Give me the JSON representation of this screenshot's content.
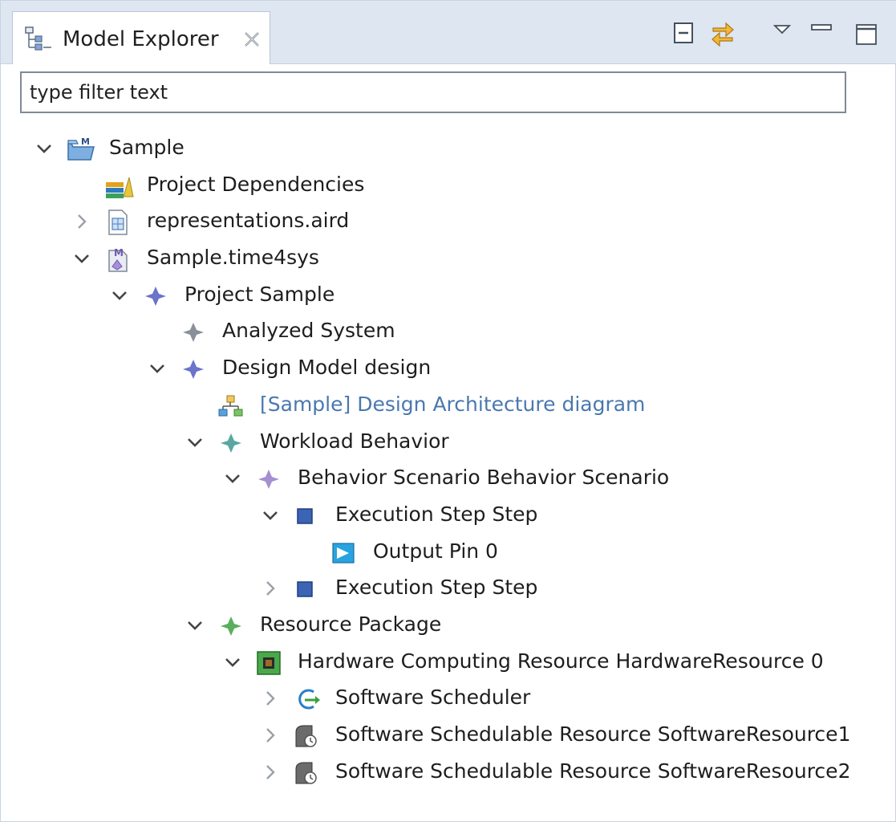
{
  "view": {
    "title": "Model Explorer",
    "filter_value": "type filter text"
  },
  "toolbar": {
    "buttons": [
      "collapse-all-icon",
      "link-with-editor-icon",
      "view-menu-icon",
      "minimize-icon",
      "maximize-icon"
    ]
  },
  "tree": [
    {
      "label": "Sample",
      "depth": 0,
      "toggle": "expanded",
      "icon": "project-folder-icon"
    },
    {
      "label": "Project Dependencies",
      "depth": 1,
      "toggle": "none",
      "icon": "dependencies-icon"
    },
    {
      "label": "representations.aird",
      "depth": 1,
      "toggle": "collapsed",
      "icon": "aird-file-icon"
    },
    {
      "label": "Sample.time4sys",
      "depth": 1,
      "toggle": "expanded",
      "icon": "model-file-icon"
    },
    {
      "label": "Project Sample",
      "depth": 2,
      "toggle": "expanded",
      "icon": "diamond-icon",
      "color": "#6b74c9"
    },
    {
      "label": "Analyzed System",
      "depth": 3,
      "toggle": "none",
      "icon": "diamond-icon",
      "color": "#8a8f99"
    },
    {
      "label": "Design Model design",
      "depth": 3,
      "toggle": "expanded",
      "icon": "diamond-icon",
      "color": "#6b74c9"
    },
    {
      "label": "[Sample] Design Architecture diagram",
      "depth": 4,
      "toggle": "none",
      "icon": "diagram-icon",
      "link": true
    },
    {
      "label": "Workload Behavior",
      "depth": 4,
      "toggle": "expanded",
      "icon": "diamond-icon",
      "color": "#5aa7a0"
    },
    {
      "label": "Behavior Scenario Behavior Scenario",
      "depth": 5,
      "toggle": "expanded",
      "icon": "diamond-icon",
      "color": "#a58fd0"
    },
    {
      "label": "Execution Step Step",
      "depth": 6,
      "toggle": "expanded",
      "icon": "square-icon",
      "color": "#3b64b5"
    },
    {
      "label": "Output Pin 0",
      "depth": 7,
      "toggle": "none",
      "icon": "output-pin-icon"
    },
    {
      "label": "Execution Step Step",
      "depth": 6,
      "toggle": "collapsed",
      "icon": "square-icon",
      "color": "#3b64b5"
    },
    {
      "label": "Resource Package",
      "depth": 4,
      "toggle": "expanded",
      "icon": "diamond-icon",
      "color": "#5bae5f"
    },
    {
      "label": "Hardware Computing Resource HardwareResource 0",
      "depth": 5,
      "toggle": "expanded",
      "icon": "chip-icon"
    },
    {
      "label": "Software Scheduler",
      "depth": 6,
      "toggle": "collapsed",
      "icon": "scheduler-icon"
    },
    {
      "label": "Software Schedulable Resource SoftwareResource1",
      "depth": 6,
      "toggle": "collapsed",
      "icon": "schedulable-resource-icon"
    },
    {
      "label": "Software Schedulable Resource SoftwareResource2",
      "depth": 6,
      "toggle": "collapsed",
      "icon": "schedulable-resource-icon"
    }
  ]
}
